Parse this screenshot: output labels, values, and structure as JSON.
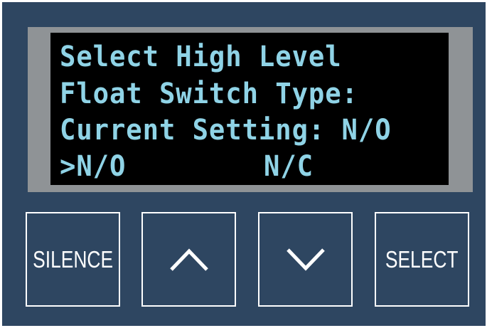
{
  "display": {
    "line1": "Select High Level",
    "line2": "Float Switch Type:",
    "line3": "Current Setting: N/O",
    "options": [
      {
        "cursor": ">",
        "label": "N/O",
        "selected": true
      },
      {
        "cursor": "",
        "label": "N/C",
        "selected": false
      }
    ]
  },
  "buttons": {
    "silence_label": "SILENCE",
    "up_icon": "chevron-up-icon",
    "down_icon": "chevron-down-icon",
    "select_label": "SELECT"
  },
  "colors": {
    "panel": "#2e4661",
    "bezel": "#8f9396",
    "lcd_background": "#000000",
    "lcd_text": "#8fd3e6",
    "button_border": "#ffffff"
  }
}
